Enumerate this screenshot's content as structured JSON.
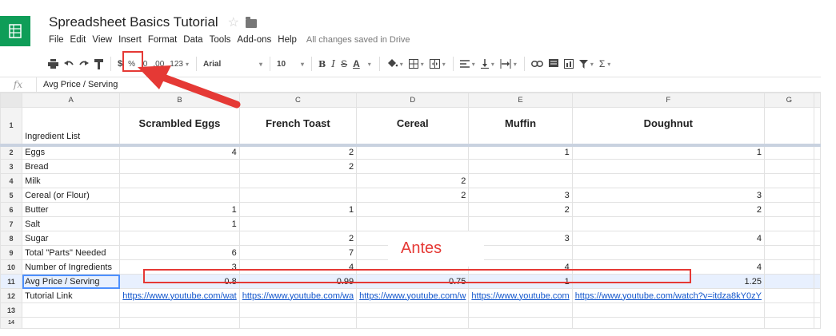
{
  "app": {
    "title": "Spreadsheet Basics Tutorial",
    "save_status": "All changes saved in Drive",
    "menu": [
      "File",
      "Edit",
      "View",
      "Insert",
      "Format",
      "Data",
      "Tools",
      "Add-ons",
      "Help"
    ]
  },
  "toolbar": {
    "currency": "$",
    "percent": "%",
    "decrease_decimal": ".0",
    "increase_decimal": ".00",
    "more_formats": "123",
    "font": "Arial",
    "font_size": "10",
    "bold": "B",
    "italic": "I",
    "strikethrough": "S",
    "text_color": "A",
    "link_icon": "link-icon",
    "sum": "Σ"
  },
  "formula_bar": {
    "fx": "fx",
    "value": "Avg Price / Serving"
  },
  "grid": {
    "columns": [
      "A",
      "B",
      "C",
      "D",
      "E",
      "F",
      "G"
    ],
    "header_row": {
      "row_num": "1",
      "cells": [
        "Ingredient List",
        "Scrambled Eggs",
        "French Toast",
        "Cereal",
        "Muffin",
        "Doughnut",
        ""
      ]
    },
    "rows": [
      {
        "n": "2",
        "cells": [
          "Eggs",
          "4",
          "2",
          "",
          "1",
          "1",
          ""
        ]
      },
      {
        "n": "3",
        "cells": [
          "Bread",
          "",
          "2",
          "",
          "",
          "",
          ""
        ]
      },
      {
        "n": "4",
        "cells": [
          "Milk",
          "",
          "",
          "2",
          "",
          "",
          ""
        ]
      },
      {
        "n": "5",
        "cells": [
          "Cereal (or Flour)",
          "",
          "",
          "2",
          "3",
          "3",
          ""
        ]
      },
      {
        "n": "6",
        "cells": [
          "Butter",
          "1",
          "1",
          "",
          "2",
          "2",
          ""
        ]
      },
      {
        "n": "7",
        "cells": [
          "Salt",
          "1",
          "",
          "",
          "",
          "",
          ""
        ]
      },
      {
        "n": "8",
        "cells": [
          "Sugar",
          "",
          "2",
          "",
          "3",
          "4",
          ""
        ]
      },
      {
        "n": "9",
        "cells": [
          "Total \"Parts\" Needed",
          "6",
          "7",
          "",
          "",
          "",
          ""
        ]
      },
      {
        "n": "10",
        "cells": [
          "Number of Ingredients",
          "3",
          "4",
          "",
          "4",
          "4",
          ""
        ]
      },
      {
        "n": "11",
        "cells": [
          "Avg Price / Serving",
          "0.8",
          "0.99",
          "0.75",
          "1",
          "1.25",
          ""
        ]
      },
      {
        "n": "12",
        "cells": [
          "Tutorial Link",
          "https://www.youtube.com/wat",
          "https://www.youtube.com/wa",
          "https://www.youtube.com/w",
          "https://www.youtube.com",
          "https://www.youtube.com/watch?v=itdza8kY0zY",
          ""
        ]
      },
      {
        "n": "13",
        "cells": [
          "",
          "",
          "",
          "",
          "",
          "",
          ""
        ]
      }
    ],
    "last_row_num": "14"
  },
  "annotation": {
    "label": "Antes",
    "color": "#e53935"
  }
}
